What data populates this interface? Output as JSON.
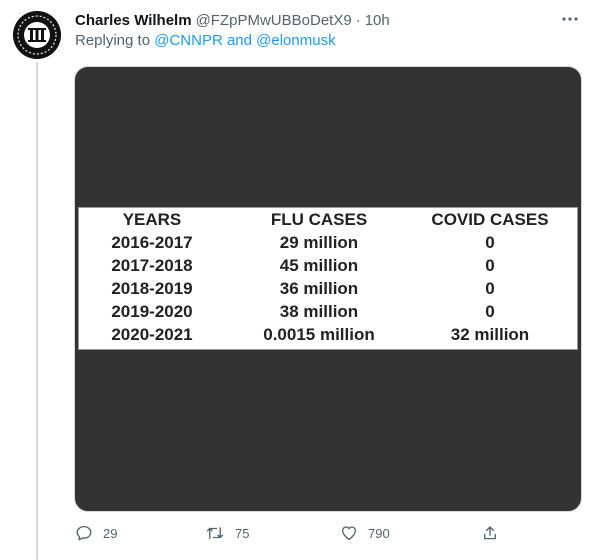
{
  "tweet": {
    "author_name": "Charles Wilhelm",
    "handle": "@FZpPMwUBBoDetX9",
    "separator": "·",
    "time": "10h",
    "replying_prefix": "Replying to",
    "reply_to_1": "@CNNPR",
    "reply_and": "and",
    "reply_to_2": "@elonmusk"
  },
  "image_table": {
    "headers": [
      "YEARS",
      "FLU CASES",
      "COVID CASES"
    ],
    "rows": [
      [
        "2016-2017",
        "29 million",
        "0"
      ],
      [
        "2017-2018",
        "45 million",
        "0"
      ],
      [
        "2018-2019",
        "36 million",
        "0"
      ],
      [
        "2019-2020",
        "38 million",
        "0"
      ],
      [
        "2020-2021",
        "0.0015 million",
        "32 million"
      ]
    ]
  },
  "actions": {
    "replies": "29",
    "retweets": "75",
    "likes": "790"
  },
  "colors": {
    "link": "#1d9bf0",
    "secondary_text": "#536471",
    "media_background": "#333333"
  },
  "icons": [
    "more-icon",
    "reply-icon",
    "retweet-icon",
    "like-icon",
    "share-icon"
  ]
}
